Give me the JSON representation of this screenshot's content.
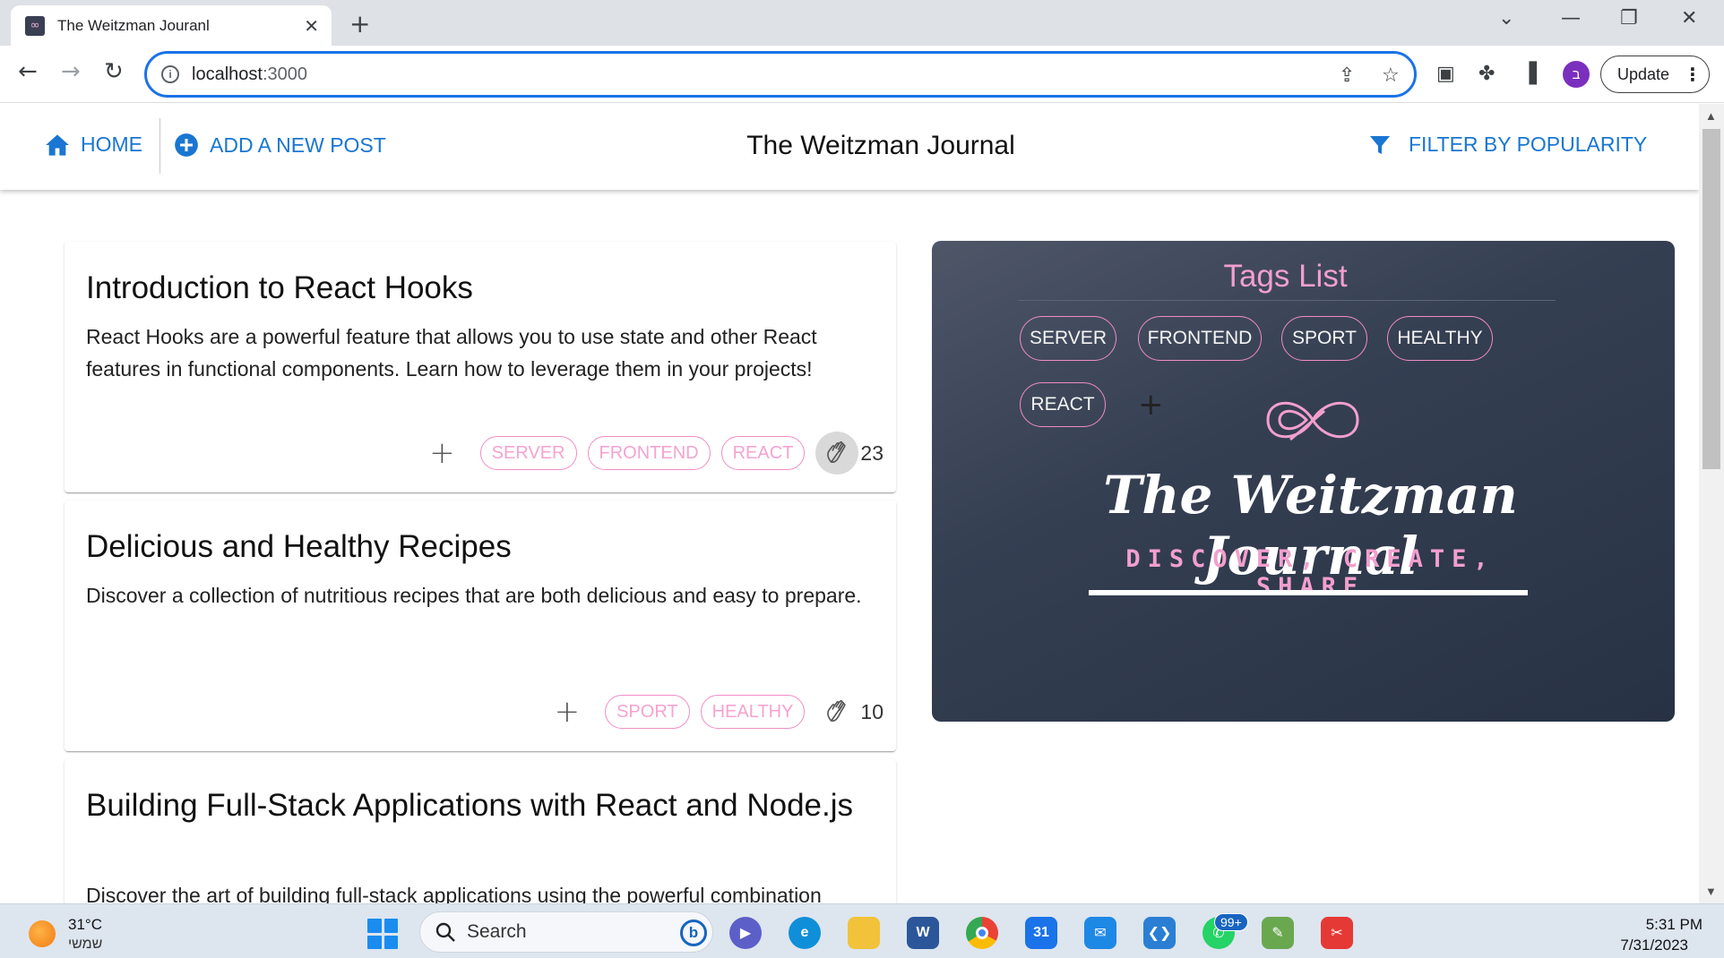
{
  "browser": {
    "tab_title": "The Weitzman Jouranl",
    "url_host": "localhost",
    "url_port": ":3000",
    "update_label": "Update",
    "profile_initial": "ב"
  },
  "appbar": {
    "home_label": "HOME",
    "add_post_label": "ADD A NEW POST",
    "title": "The Weitzman Journal",
    "filter_label": "FILTER BY POPULARITY"
  },
  "posts": [
    {
      "title": "Introduction to React Hooks",
      "body": "React Hooks are a powerful feature that allows you to use state and other React features in functional components. Learn how to leverage them in your projects!",
      "tags": [
        "SERVER",
        "FRONTEND",
        "REACT"
      ],
      "claps": "23",
      "clap_active": true
    },
    {
      "title": "Delicious and Healthy Recipes",
      "body": "Discover a collection of nutritious recipes that are both delicious and easy to prepare.",
      "tags": [
        "SPORT",
        "HEALTHY"
      ],
      "claps": "10",
      "clap_active": false
    },
    {
      "title": "Building Full-Stack Applications with React and Node.js",
      "body": "Discover the art of building full-stack applications using the powerful combination"
    }
  ],
  "tags_panel": {
    "title": "Tags List",
    "tags": [
      "SERVER",
      "FRONTEND",
      "SPORT",
      "HEALTHY",
      "REACT"
    ],
    "logo_title": "The Weitzman Journal",
    "logo_subtitle": "DISCOVER, CREATE, SHARE"
  },
  "taskbar": {
    "temperature": "31°C",
    "weather": "שמשי",
    "search_label": "Search",
    "notification_badge": "99+",
    "time": "5:31 PM",
    "date": "7/31/2023"
  },
  "colors": {
    "accent_blue": "#1976d2",
    "pink": "#f29fce",
    "panel_dark": "#353f52"
  }
}
